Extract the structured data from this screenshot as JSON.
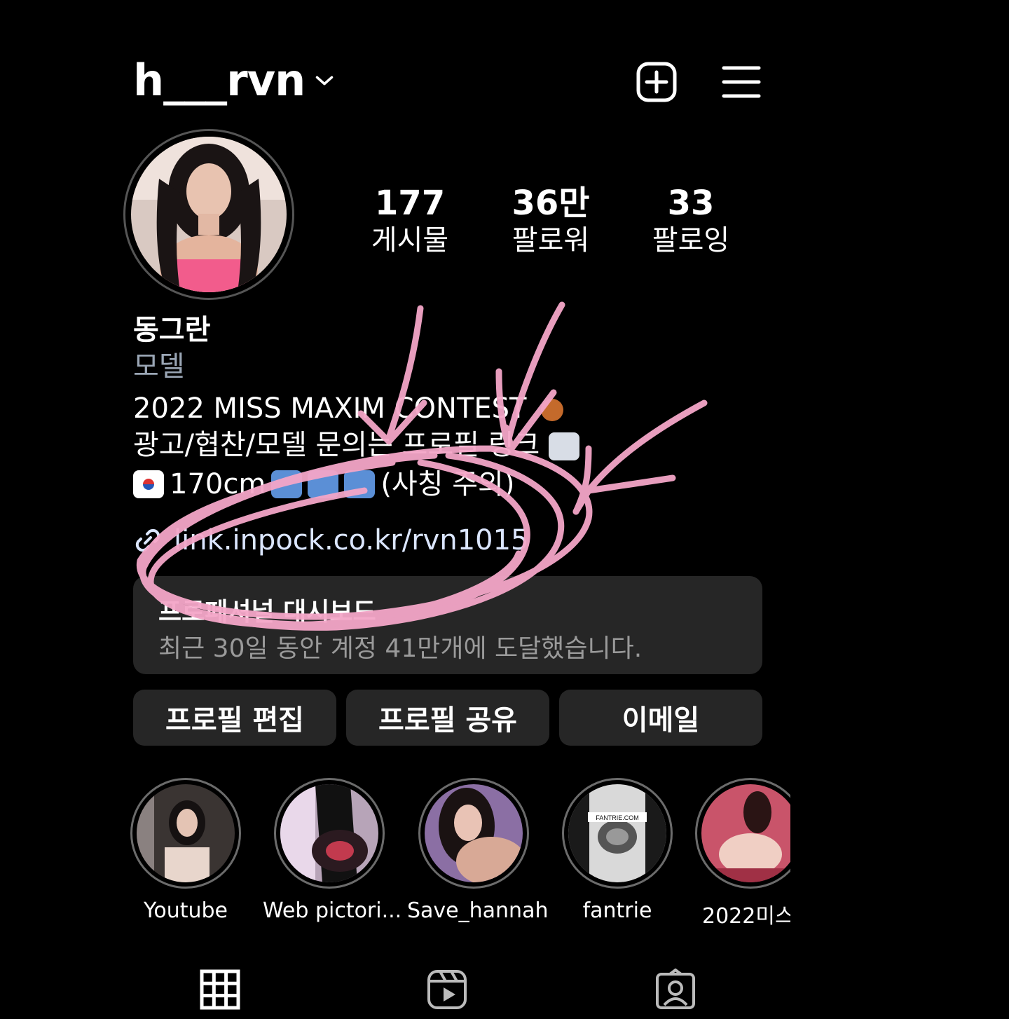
{
  "header": {
    "username": "h___rvn",
    "icons": [
      "chevron-down-icon",
      "add-square-icon",
      "hamburger-menu-icon"
    ]
  },
  "stats": [
    {
      "value": "177",
      "label": "게시물"
    },
    {
      "value": "36만",
      "label": "팔로워"
    },
    {
      "value": "33",
      "label": "팔로잉"
    }
  ],
  "bio": {
    "name": "동그란",
    "category": "모델",
    "line1": "2022 MISS MAXIM CONTEST",
    "line2": "광고/협찬/모델 문의는 프로필 링크",
    "line3_height": "170cm",
    "line3_note": "(사칭 주의)",
    "link": "link.inpock.co.kr/rvn1015"
  },
  "dashboard": {
    "title": "프로페셔널 대시보드",
    "subtitle": "최근 30일 동안 계정 41만개에 도달했습니다."
  },
  "buttons": {
    "edit": "프로필 편집",
    "share": "프로필 공유",
    "email": "이메일"
  },
  "highlights": [
    {
      "label": "Youtube"
    },
    {
      "label": "Web pictori..."
    },
    {
      "label": "Save_hannah"
    },
    {
      "label": "fantrie"
    },
    {
      "label": "2022미스"
    }
  ],
  "highlight_badge": "FANTRIE.COM",
  "tabs": [
    "grid-icon",
    "reels-icon",
    "tagged-icon"
  ],
  "colors": {
    "background": "#000000",
    "card": "#262626",
    "category": "#9aa6b5",
    "scribble": "#f4a6c8"
  }
}
